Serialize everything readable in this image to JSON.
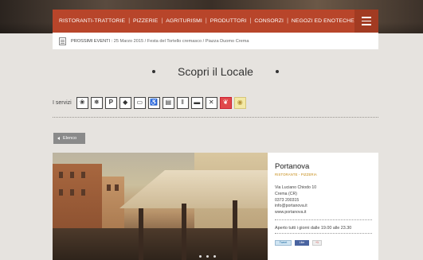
{
  "nav": {
    "items": [
      "RISTORANTI-TRATTORIE",
      "PIZZERIE",
      "AGRITURISMI",
      "PRODUTTORI",
      "CONSORZI",
      "NEGOZI ED ENOTECHE"
    ],
    "separator": "|"
  },
  "events": {
    "label": "PROSSIMI EVENTI :",
    "date": "25 Marzo 2015",
    "event_name": "Festa del Tortello cremasco",
    "location": "Piazza Duomo Crema",
    "divider": "/"
  },
  "page": {
    "title": "Scopri il Locale"
  },
  "services": {
    "label": "I servizi",
    "icons": [
      "vegetarian-icon",
      "air-conditioning-icon",
      "parking-icon",
      "directions-icon",
      "credit-card-icon",
      "wheelchair-icon",
      "menu-icon",
      "cutlery-icon",
      "terrace-icon",
      "no-smoking-icon",
      "pets-icon",
      "wifi-icon"
    ]
  },
  "back_button": {
    "label": "Elenco"
  },
  "venue": {
    "name": "Portanova",
    "category": "RISTORANTE - PIZZERIA",
    "address_line1": "Via Luciano Chiodo 10",
    "address_line2": "Crema (CR)",
    "phone": "0373 200315",
    "email": "info@portanova.it",
    "website": "www.portanova.it",
    "hours": "Aperto tutti i giorni dalle 19.00 alle 23.30"
  },
  "social": {
    "tweet_label": "Tweet",
    "like_label": "Like",
    "plus_label": "+1"
  },
  "colors": {
    "nav_bg": "#b8452a",
    "accent_gold": "#c58a14",
    "page_bg": "#e6e3df"
  }
}
